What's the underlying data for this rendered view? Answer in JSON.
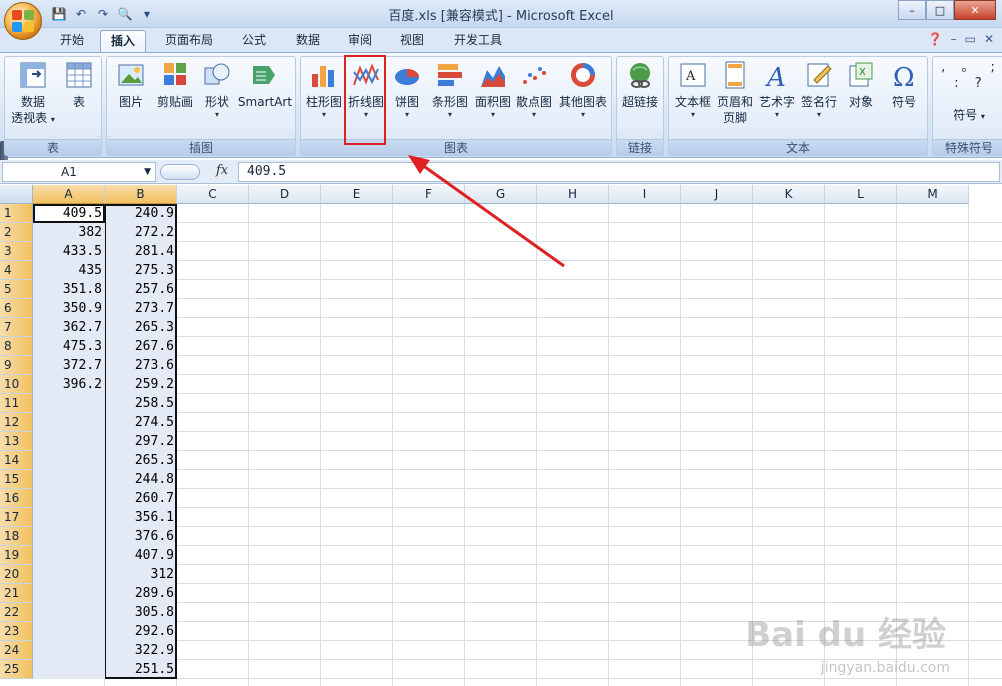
{
  "window": {
    "title": "百度.xls  [兼容模式] - Microsoft Excel",
    "controls": [
      "–",
      "□",
      "✕"
    ]
  },
  "tabs": [
    "开始",
    "插入",
    "页面布局",
    "公式",
    "数据",
    "审阅",
    "视图",
    "开发工具"
  ],
  "active_tab": "插入",
  "ribbon": {
    "groups": [
      {
        "label": "表",
        "buttons": [
          "数据透视表",
          "表"
        ]
      },
      {
        "label": "插图",
        "buttons": [
          "图片",
          "剪贴画",
          "形状",
          "SmartArt"
        ]
      },
      {
        "label": "图表",
        "buttons": [
          "柱形图",
          "折线图",
          "饼图",
          "条形图",
          "面积图",
          "散点图",
          "其他图表"
        ]
      },
      {
        "label": "链接",
        "buttons": [
          "超链接"
        ]
      },
      {
        "label": "文本",
        "buttons": [
          "文本框",
          "页眉和页脚",
          "艺术字",
          "签名行",
          "对象",
          "符号"
        ]
      },
      {
        "label": "特殊符号",
        "buttons": [
          "符号"
        ]
      }
    ],
    "pivot_line1": "数据",
    "pivot_line2": "透视表",
    "header_line1": "页眉和",
    "header_line2": "页脚",
    "special_symbols": ", 。 ; : ?"
  },
  "formula_bar": {
    "name_box": "A1",
    "fx": "fx",
    "value": "409.5"
  },
  "columns": [
    "A",
    "B",
    "C",
    "D",
    "E",
    "F",
    "G",
    "H",
    "I",
    "J",
    "K",
    "L",
    "M"
  ],
  "rows": [
    "1",
    "2",
    "3",
    "4",
    "5",
    "6",
    "7",
    "8",
    "9",
    "10",
    "11",
    "12",
    "13",
    "14",
    "15",
    "16",
    "17",
    "18",
    "19",
    "20",
    "21",
    "22",
    "23",
    "24",
    "25"
  ],
  "column_A": [
    "409.5",
    "382",
    "433.5",
    "435",
    "351.8",
    "350.9",
    "362.7",
    "475.3",
    "372.7",
    "396.2"
  ],
  "column_B": [
    "240.9",
    "272.2",
    "281.4",
    "275.3",
    "257.6",
    "273.7",
    "265.3",
    "267.6",
    "273.6",
    "259.2",
    "258.5",
    "274.5",
    "297.2",
    "265.3",
    "244.8",
    "260.7",
    "356.1",
    "376.6",
    "407.9",
    "312",
    "289.6",
    "305.8",
    "292.6",
    "322.9",
    "251.5"
  ],
  "watermark": {
    "text": "Bai du 经验",
    "sub": "jingyan.baidu.com"
  },
  "colors": {
    "accent": "#e02020",
    "ribbon": "#dbe7f6",
    "selection": "#e3e9f5"
  }
}
